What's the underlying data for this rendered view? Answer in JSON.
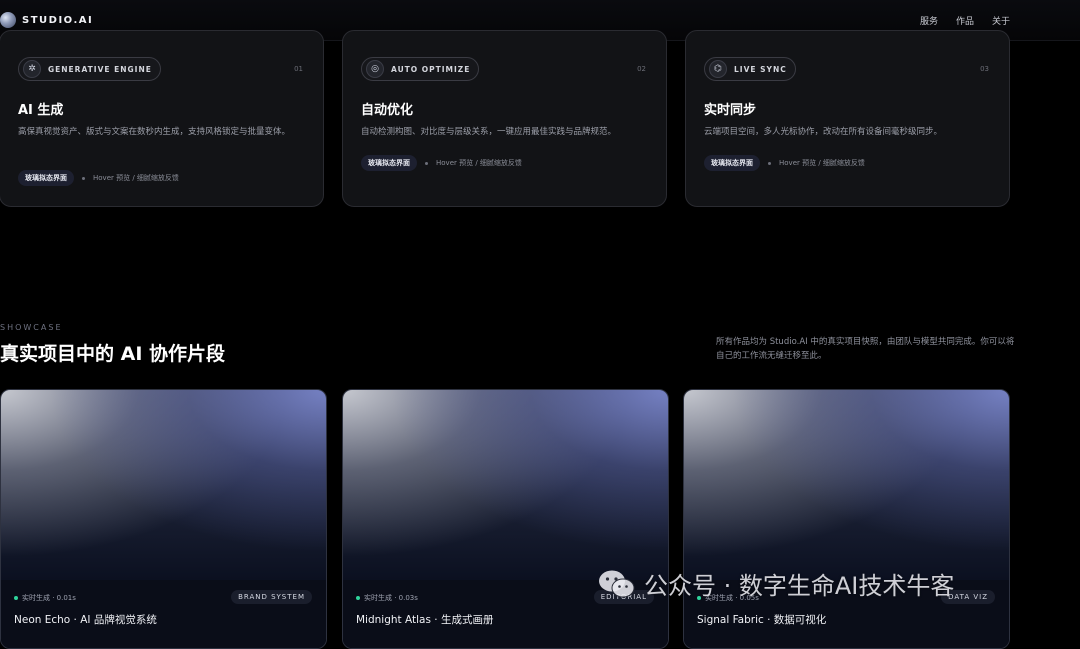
{
  "nav": {
    "logo_text": "STUDIO.AI",
    "links": [
      "服务",
      "作品",
      "关于"
    ]
  },
  "features": [
    {
      "icon": "spark-icon",
      "pill": "GENERATIVE ENGINE",
      "num": "01",
      "title": "AI 生成",
      "desc": "高保真视觉资产、版式与文案在数秒内生成，支持风格锁定与批量变体。",
      "tag": "玻璃拟态界面",
      "note": "Hover 预览 / 细腻缩放反馈"
    },
    {
      "icon": "gauge-icon",
      "pill": "AUTO OPTIMIZE",
      "num": "02",
      "title": "自动优化",
      "desc": "自动检测构图、对比度与层级关系，一键应用最佳实践与品牌规范。",
      "tag": "玻璃拟态界面",
      "note": "Hover 预览 / 细腻缩放反馈"
    },
    {
      "icon": "broadcast-icon",
      "pill": "LIVE SYNC",
      "num": "03",
      "title": "实时同步",
      "desc": "云端项目空间，多人光标协作，改动在所有设备间毫秒级同步。",
      "tag": "玻璃拟态界面",
      "note": "Hover 预览 / 细腻缩放反馈"
    }
  ],
  "showcase": {
    "eyebrow": "SHOWCASE",
    "title": "真实项目中的 AI 协作片段",
    "desc": "所有作品均为 Studio.AI 中的真实项目快照，由团队与模型共同完成。你可以将自己的工作流无缝迁移至此。",
    "items": [
      {
        "meta": "实时生成 · 0.01s",
        "badge": "BRAND SYSTEM",
        "title": "Neon Echo · AI 品牌视觉系统"
      },
      {
        "meta": "实时生成 · 0.03s",
        "badge": "EDITORIAL",
        "title": "Midnight Atlas · 生成式画册"
      },
      {
        "meta": "实时生成 · 0.05s",
        "badge": "DATA VIZ",
        "title": "Signal Fabric · 数据可视化"
      }
    ]
  },
  "watermark": {
    "text": "公众号 · 数字生命AI技术牛客"
  }
}
